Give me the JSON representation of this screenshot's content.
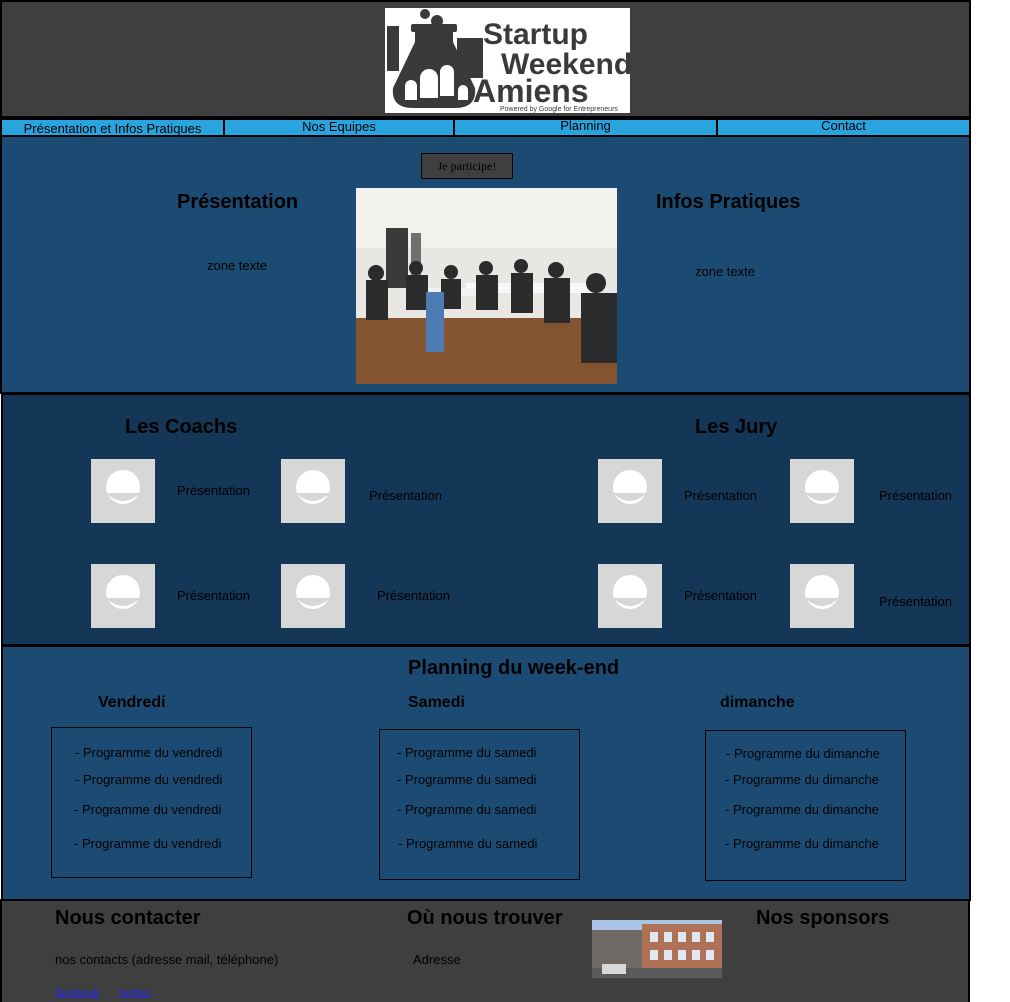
{
  "nav": [
    "Présentation et Infos Pratiques",
    "Nos Equipes",
    "Planning",
    "Contact"
  ],
  "cta": "Je participe!",
  "presentation": {
    "title": "Présentation",
    "text": "zone texte",
    "infos_title": "Infos Pratiques",
    "infos_text": "zone texte"
  },
  "teams": {
    "coachs_title": "Les Coachs",
    "jury_title": "Les Jury",
    "member_label": "Présentation"
  },
  "planning": {
    "title": "Planning du week-end",
    "days": [
      {
        "name": "Vendredi",
        "item": "- Programme du vendredi"
      },
      {
        "name": "Samedi",
        "item": "- Programme du samedi"
      },
      {
        "name": "dimanche",
        "item": "- Programme du dimanche"
      }
    ]
  },
  "footer": {
    "contact_title": "Nous contacter",
    "contact_text": "nos contacts (adresse mail, téléphone)",
    "facebook": "facebook",
    "twitter": "twitter",
    "location_title": "Où nous trouver",
    "location_text": "Adresse",
    "sponsors_title": "Nos sponsors"
  },
  "logo": {
    "line1": "Startup",
    "line2": "Weekend",
    "line3": "Amiens",
    "tagline": "Powered by Google for Entrepreneurs"
  },
  "colors": {
    "header": "#3f3f3f",
    "nav": "#29a4de",
    "section_blue": "#1b4b73",
    "section_dark_blue": "#143657"
  }
}
